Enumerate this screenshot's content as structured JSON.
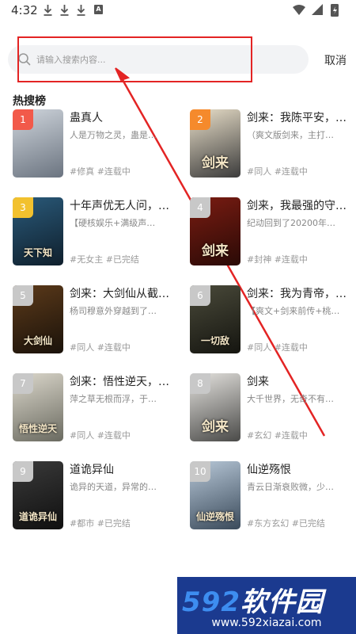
{
  "status": {
    "time": "4:32",
    "box_label": "A"
  },
  "search": {
    "placeholder": "请输入搜索内容...",
    "cancel_label": "取消"
  },
  "section_title": "热搜榜",
  "books": [
    {
      "rank": "1",
      "badge_color": "#f25a4a",
      "title": "蛊真人",
      "desc": "人是万物之灵，蛊是…",
      "tags": "#修真 #连载中",
      "cover_text": "",
      "cover_colors": [
        "#cfd5dc",
        "#6b7480"
      ]
    },
    {
      "rank": "2",
      "badge_color": "#f58a2c",
      "title": "剑来：我陈平安，…",
      "desc": "（爽文版剑来，主打…",
      "tags": "#同人 #连载中",
      "cover_text": "剑来",
      "cover_colors": [
        "#e9dfc9",
        "#3b3b3b"
      ]
    },
    {
      "rank": "3",
      "badge_color": "#f2c12e",
      "title": "十年声优无人问，…",
      "desc": "【硬核娱乐+满级声…",
      "tags": "#无女主 #已完结",
      "cover_text": "天下知",
      "cover_colors": [
        "#2a5a7a",
        "#0f1f2c"
      ]
    },
    {
      "rank": "4",
      "badge_color": "#c8c8c8",
      "title": "剑来，我最强的守…",
      "desc": "纪动回到了20200年…",
      "tags": "#封神 #连载中",
      "cover_text": "剑来",
      "cover_colors": [
        "#7a1c12",
        "#2a0a06"
      ]
    },
    {
      "rank": "5",
      "badge_color": "#c8c8c8",
      "title": "剑来：大剑仙从截…",
      "desc": "杨司穆意外穿越到了…",
      "tags": "#同人 #连载中",
      "cover_text": "大剑仙",
      "cover_colors": [
        "#5c3a1a",
        "#1a120a"
      ]
    },
    {
      "rank": "6",
      "badge_color": "#c8c8c8",
      "title": "剑来：我为青帝，…",
      "desc": "【爽文+剑来前传+桃…",
      "tags": "#同人 #连载中",
      "cover_text": "一切敌",
      "cover_colors": [
        "#4a4a3a",
        "#151510"
      ]
    },
    {
      "rank": "7",
      "badge_color": "#c8c8c8",
      "title": "剑来：悟性逆天，…",
      "desc": "萍之草无根而浮，于…",
      "tags": "#同人 #连载中",
      "cover_text": "悟性逆天",
      "cover_colors": [
        "#dcd8cc",
        "#6a6a60"
      ]
    },
    {
      "rank": "8",
      "badge_color": "#c8c8c8",
      "title": "剑来",
      "desc": "大千世界，无奇不有…",
      "tags": "#玄幻 #连载中",
      "cover_text": "剑来",
      "cover_colors": [
        "#e4e2de",
        "#4a4a48"
      ]
    },
    {
      "rank": "9",
      "badge_color": "#c8c8c8",
      "title": "道诡异仙",
      "desc": "诡异的天道，异常的…",
      "tags": "#都市 #已完结",
      "cover_text": "道诡异仙",
      "cover_colors": [
        "#3a3a3a",
        "#101010"
      ]
    },
    {
      "rank": "10",
      "badge_color": "#c8c8c8",
      "title": "仙逆殇恨",
      "desc": "青云日渐衰败微，少…",
      "tags": "#东方玄幻 #已完结",
      "cover_text": "仙逆殇恨",
      "cover_colors": [
        "#b8c8d8",
        "#3a4a5a"
      ]
    }
  ],
  "watermark": {
    "brand_num": "592",
    "brand_cn": "软件园",
    "url": "www.592xiazai.com"
  },
  "colors": {
    "accent_red": "#e32424",
    "watermark_bg": "#1b3a8f"
  }
}
